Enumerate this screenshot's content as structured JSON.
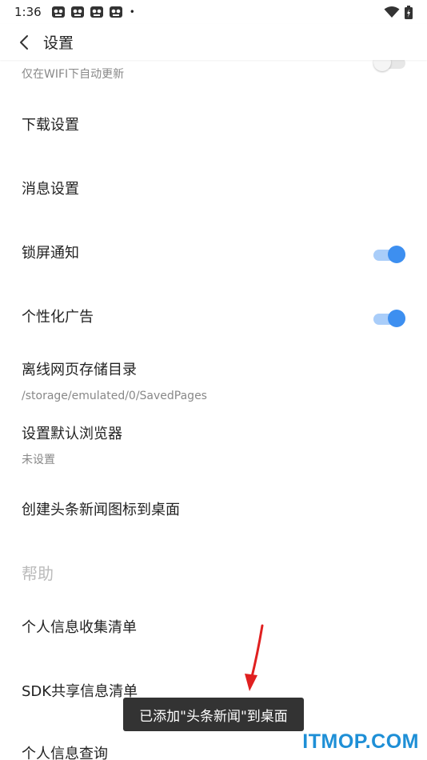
{
  "status_bar": {
    "time": "1:36",
    "dot": "•",
    "icons": [
      "app-notification-icon",
      "app-notification-icon",
      "app-notification-icon",
      "app-notification-icon",
      "wifi-icon",
      "battery-icon"
    ]
  },
  "header": {
    "title": "设置",
    "back_icon": "chevron-left-icon"
  },
  "settings": {
    "wifi_update": {
      "label": "仅在WIFI下自动更新",
      "toggle": "off"
    },
    "download": {
      "label": "下载设置"
    },
    "message": {
      "label": "消息设置"
    },
    "lock_screen": {
      "label": "锁屏通知",
      "toggle": "on"
    },
    "personalized_ads": {
      "label": "个性化广告",
      "toggle": "on"
    },
    "offline_dir": {
      "label": "离线网页存储目录",
      "value": "/storage/emulated/0/SavedPages"
    },
    "default_browser": {
      "label": "设置默认浏览器",
      "value": "未设置"
    },
    "desktop_icon": {
      "label": "创建头条新闻图标到桌面"
    }
  },
  "help": {
    "header": "帮助",
    "personal_info_list": "个人信息收集清单",
    "sdk_list": "SDK共享信息清单",
    "personal_info_query": "个人信息查询"
  },
  "toast": {
    "message": "已添加\"头条新闻\"到桌面"
  },
  "watermark": {
    "text": "ITMOP.COM"
  },
  "colors": {
    "toggle_on": "#3d8ff0",
    "toggle_on_track": "#a9cdf9",
    "toast_bg": "#333333",
    "arrow": "#e02020",
    "watermark": "#1e8fd6"
  }
}
